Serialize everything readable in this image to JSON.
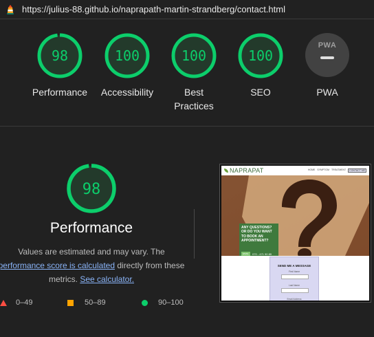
{
  "header": {
    "url": "https://julius-88.github.io/naprapath-martin-strandberg/contact.html"
  },
  "scores": [
    {
      "label": "Performance",
      "value": "98"
    },
    {
      "label": "Accessibility",
      "value": "100"
    },
    {
      "label_line1": "Best",
      "label_line2": "Practices",
      "value": "100"
    },
    {
      "label": "SEO",
      "value": "100"
    }
  ],
  "pwa": {
    "badge": "PWA",
    "label": "PWA"
  },
  "performance_detail": {
    "score": "98",
    "title": "Performance",
    "desc_line1": "Values are estimated and may vary. The",
    "desc_link1": "performance score is calculated",
    "desc_line2_rest": " directly from these",
    "desc_line3_start": "metrics. ",
    "desc_link2": "See calculator."
  },
  "legend": {
    "fail": "0–49",
    "average": "50–89",
    "pass": "90–100"
  },
  "screenshot": {
    "logo": "NAPRAPAT",
    "nav": [
      "HOME",
      "SYMPTOM",
      "TREATMENT",
      "CONTACT ME"
    ],
    "cta_text": "ANY QUESTIONS? OR DO YOU WANT TO BOOK AN APPOINTMENT?",
    "cta_button": "EMAIL",
    "cta_phone": "070 - 471 90 89",
    "form_title": "SEND ME A MESSAGE",
    "form_label1": "First Name",
    "form_label2": "Last Name",
    "form_label3": "Email Address"
  },
  "colors": {
    "pass": "#0cce6b",
    "average": "#ffa400",
    "fail": "#ff4e42",
    "background": "#212121",
    "link": "#8ab4f8"
  }
}
